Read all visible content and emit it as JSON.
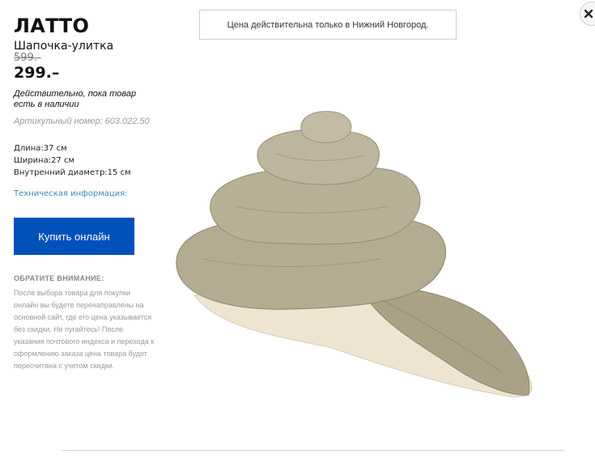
{
  "product": {
    "name": "ЛАТТО",
    "type": "Шапочка-улитка",
    "old_price": "599.-",
    "price": "299.–",
    "validity": "Действительно, пока товар есть в наличии",
    "article": "Артикульный номер: 603.022.50",
    "dimensions": [
      "Длина:37 см",
      "Ширина:27 см",
      "Внутренний диаметр:15 см"
    ],
    "tech_info_link": "Техническая информация:",
    "buy_button": "Купить онлайн"
  },
  "note": {
    "heading": "ОБРАТИТЕ ВНИМАНИЕ:",
    "body": "После выбора товара для покупки онлайн вы будете перенаправлены на основной сайт, где его цена указывается без скидки. Не пугайтесь! После указания почтового индекса и перехода к оформлению заказа цена товара будет пересчитана с учетом скидки."
  },
  "notice": "Цена действительна только в Нижний Новгород.",
  "colors": {
    "buy_button_bg": "#0051ba",
    "link": "#3b87c4",
    "product_main": "#b3ab92",
    "product_lining": "#efe4d2"
  },
  "icons": {
    "close": "close-icon"
  }
}
